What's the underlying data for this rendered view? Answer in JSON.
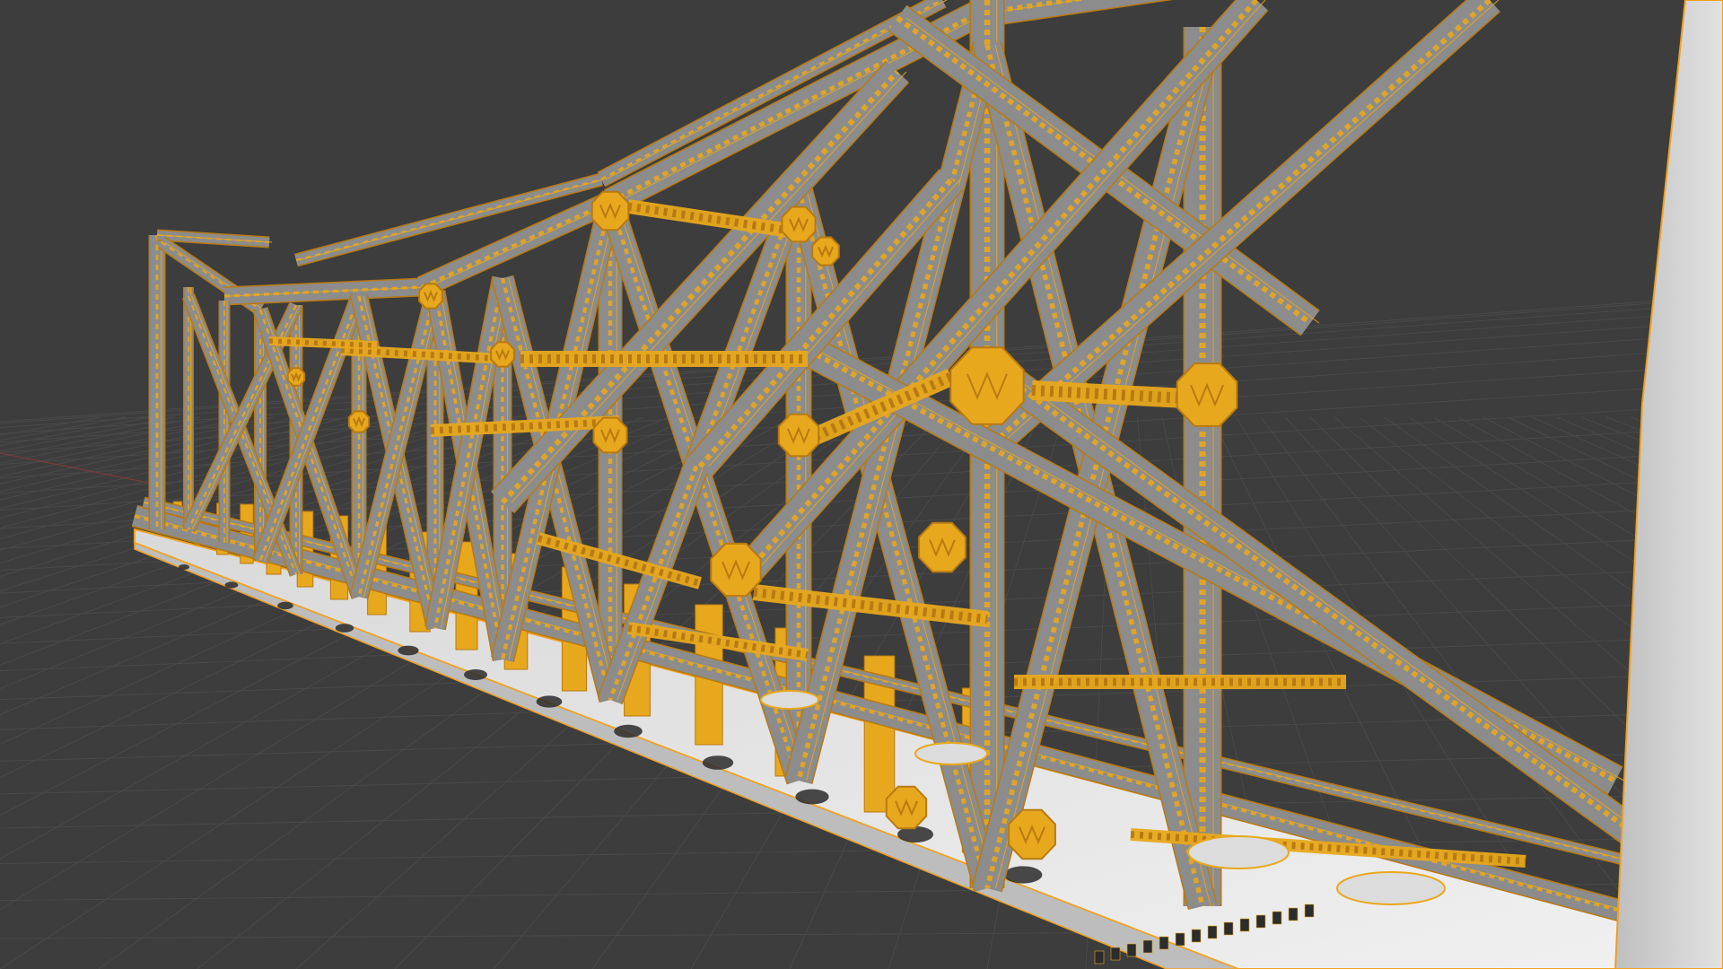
{
  "viewport": {
    "mode": "3d-viewport",
    "object_name": "truss-bridge",
    "display": "solid-with-wireframe-overlay",
    "selected": true
  },
  "colors": {
    "background": "#3d3d3d",
    "grid_line": "#4a4a4a",
    "grid_line_major": "#525252",
    "axis_x": "#8a3a3a",
    "selection_outline": "#f0a020",
    "wire": "#e8a81e",
    "wire_dark": "#b87a10",
    "member_face": "#8c8c8c",
    "member_face_light": "#a6a6a6",
    "deck": "#e6e6e6",
    "deck_shadow": "#c8c8c8",
    "hole": "#2a2a2a",
    "side_panel": "#d2d2d2"
  },
  "icons": {
    "object": "mesh-object-icon"
  }
}
